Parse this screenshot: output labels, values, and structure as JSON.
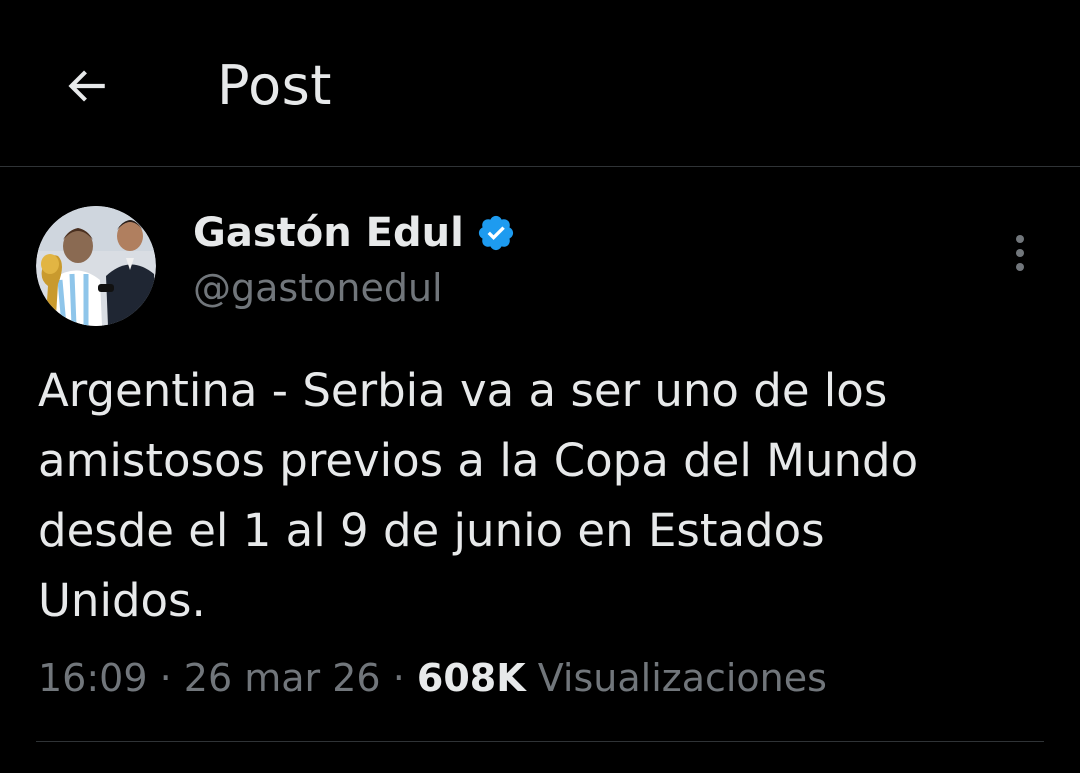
{
  "header": {
    "title": "Post",
    "back_icon": "arrow-left-icon"
  },
  "author": {
    "display_name": "Gastón Edul",
    "handle": "@gastonedul",
    "verified": true,
    "verified_color": "#1d9bf0",
    "avatar_icon": "profile-photo"
  },
  "post": {
    "text": "Argentina - Serbia va a ser uno de los\namistosos previos a la Copa del Mundo\ndesde el 1 al 9 de junio en Estados\nUnidos.",
    "time": "16:09",
    "separator": "·",
    "date": "26 mar 26",
    "views_count": "608K",
    "views_label": "Visualizaciones"
  },
  "colors": {
    "background": "#000000",
    "primary_text": "#e7e9ea",
    "secondary_text": "#71767b",
    "divider": "#2f3336"
  }
}
